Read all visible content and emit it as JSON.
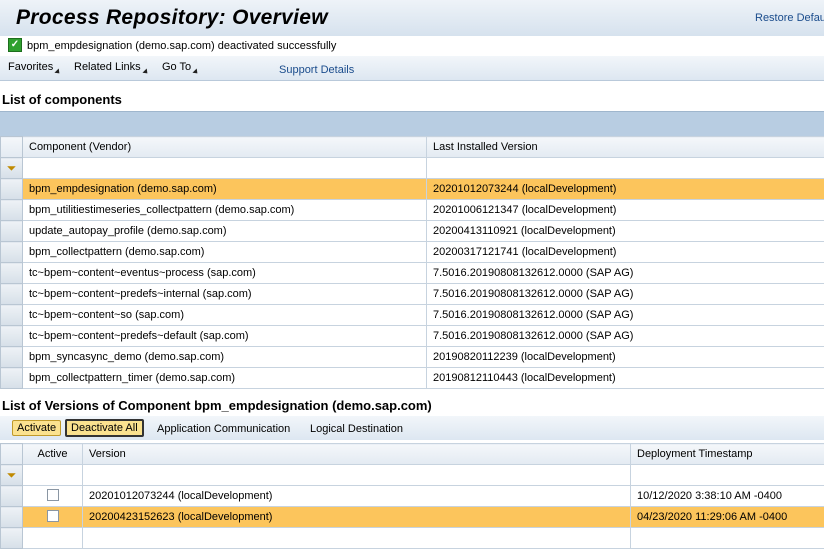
{
  "header": {
    "title": "Process Repository: Overview",
    "restore": "Restore Defau"
  },
  "message": {
    "text": "bpm_empdesignation (demo.sap.com) deactivated successfully"
  },
  "menu": {
    "favorites": "Favorites",
    "related_links": "Related Links",
    "go_to": "Go To",
    "support": "Support Details"
  },
  "components": {
    "title": "List of components",
    "columns": [
      "Component (Vendor)",
      "Last Installed Version"
    ],
    "rows": [
      {
        "component": "bpm_empdesignation (demo.sap.com)",
        "version": "20201012073244 (localDevelopment)",
        "selected": true
      },
      {
        "component": "bpm_utilitiestimeseries_collectpattern (demo.sap.com)",
        "version": "20201006121347 (localDevelopment)"
      },
      {
        "component": "update_autopay_profile (demo.sap.com)",
        "version": "20200413110921 (localDevelopment)"
      },
      {
        "component": "bpm_collectpattern (demo.sap.com)",
        "version": "20200317121741 (localDevelopment)"
      },
      {
        "component": "tc~bpem~content~eventus~process (sap.com)",
        "version": "7.5016.20190808132612.0000 (SAP AG)"
      },
      {
        "component": "tc~bpem~content~predefs~internal (sap.com)",
        "version": "7.5016.20190808132612.0000 (SAP AG)"
      },
      {
        "component": "tc~bpem~content~so (sap.com)",
        "version": "7.5016.20190808132612.0000 (SAP AG)"
      },
      {
        "component": "tc~bpem~content~predefs~default (sap.com)",
        "version": "7.5016.20190808132612.0000 (SAP AG)"
      },
      {
        "component": "bpm_syncasync_demo (demo.sap.com)",
        "version": "20190820112239 (localDevelopment)"
      },
      {
        "component": "bpm_collectpattern_timer (demo.sap.com)",
        "version": "20190812110443 (localDevelopment)"
      }
    ]
  },
  "versions": {
    "title": "List of Versions of Component bpm_empdesignation (demo.sap.com)",
    "toolbar": {
      "activate": "Activate",
      "deactivate_all": "Deactivate All",
      "app_comm": "Application Communication",
      "logical_dest": "Logical Destination"
    },
    "columns": [
      "Active",
      "Version",
      "Deployment Timestamp"
    ],
    "rows": [
      {
        "version": "20201012073244 (localDevelopment)",
        "timestamp": "10/12/2020 3:38:10 AM -0400"
      },
      {
        "version": "20200423152623 (localDevelopment)",
        "timestamp": "04/23/2020 11:29:06 AM -0400",
        "selected": true
      }
    ]
  }
}
